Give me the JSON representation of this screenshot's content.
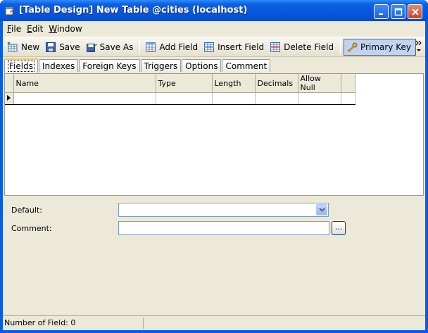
{
  "window": {
    "title": "[Table Design] New Table @cities (localhost)"
  },
  "menu": [
    {
      "label": "File",
      "mnemonic": "F",
      "rest": "ile"
    },
    {
      "label": "Edit",
      "mnemonic": "E",
      "rest": "dit"
    },
    {
      "label": "Window",
      "mnemonic": "W",
      "rest": "indow"
    }
  ],
  "toolbar": {
    "new": "New",
    "save": "Save",
    "save_as": "Save As",
    "add_field": "Add Field",
    "insert_field": "Insert Field",
    "delete_field": "Delete Field",
    "primary_key": "Primary Key"
  },
  "tabs": [
    "Fields",
    "Indexes",
    "Foreign Keys",
    "Triggers",
    "Options",
    "Comment"
  ],
  "grid": {
    "columns": [
      "Name",
      "Type",
      "Length",
      "Decimals",
      "Allow Null",
      ""
    ]
  },
  "properties": {
    "default_label": "Default:",
    "default_value": "",
    "comment_label": "Comment:",
    "comment_value": "",
    "ellipsis": "..."
  },
  "status": {
    "field_count": "Number of Field: 0"
  },
  "colors": {
    "titlebar": "#0a5ce8",
    "client": "#ece9d8",
    "primary_key_active": "#c2d3f0"
  }
}
